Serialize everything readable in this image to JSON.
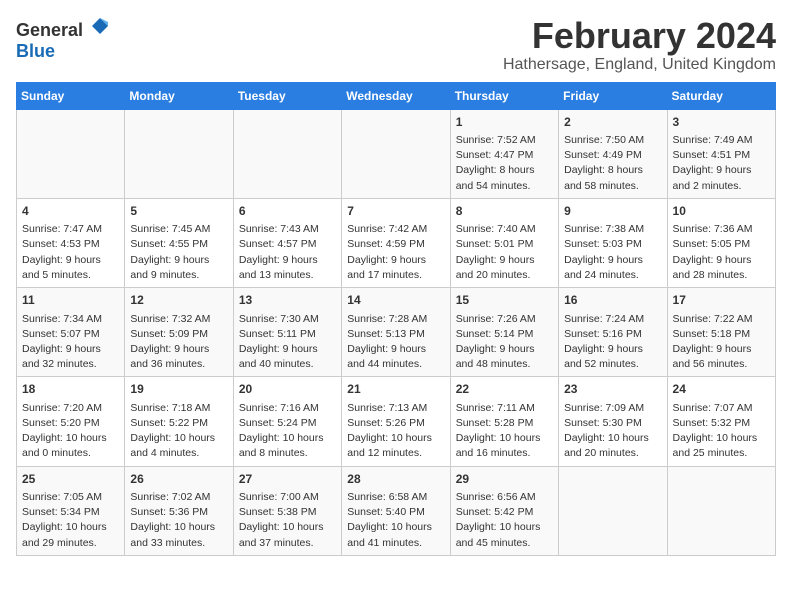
{
  "header": {
    "logo_general": "General",
    "logo_blue": "Blue",
    "month": "February 2024",
    "location": "Hathersage, England, United Kingdom"
  },
  "days_of_week": [
    "Sunday",
    "Monday",
    "Tuesday",
    "Wednesday",
    "Thursday",
    "Friday",
    "Saturday"
  ],
  "weeks": [
    [
      {
        "day": "",
        "info": ""
      },
      {
        "day": "",
        "info": ""
      },
      {
        "day": "",
        "info": ""
      },
      {
        "day": "",
        "info": ""
      },
      {
        "day": "1",
        "info": "Sunrise: 7:52 AM\nSunset: 4:47 PM\nDaylight: 8 hours\nand 54 minutes."
      },
      {
        "day": "2",
        "info": "Sunrise: 7:50 AM\nSunset: 4:49 PM\nDaylight: 8 hours\nand 58 minutes."
      },
      {
        "day": "3",
        "info": "Sunrise: 7:49 AM\nSunset: 4:51 PM\nDaylight: 9 hours\nand 2 minutes."
      }
    ],
    [
      {
        "day": "4",
        "info": "Sunrise: 7:47 AM\nSunset: 4:53 PM\nDaylight: 9 hours\nand 5 minutes."
      },
      {
        "day": "5",
        "info": "Sunrise: 7:45 AM\nSunset: 4:55 PM\nDaylight: 9 hours\nand 9 minutes."
      },
      {
        "day": "6",
        "info": "Sunrise: 7:43 AM\nSunset: 4:57 PM\nDaylight: 9 hours\nand 13 minutes."
      },
      {
        "day": "7",
        "info": "Sunrise: 7:42 AM\nSunset: 4:59 PM\nDaylight: 9 hours\nand 17 minutes."
      },
      {
        "day": "8",
        "info": "Sunrise: 7:40 AM\nSunset: 5:01 PM\nDaylight: 9 hours\nand 20 minutes."
      },
      {
        "day": "9",
        "info": "Sunrise: 7:38 AM\nSunset: 5:03 PM\nDaylight: 9 hours\nand 24 minutes."
      },
      {
        "day": "10",
        "info": "Sunrise: 7:36 AM\nSunset: 5:05 PM\nDaylight: 9 hours\nand 28 minutes."
      }
    ],
    [
      {
        "day": "11",
        "info": "Sunrise: 7:34 AM\nSunset: 5:07 PM\nDaylight: 9 hours\nand 32 minutes."
      },
      {
        "day": "12",
        "info": "Sunrise: 7:32 AM\nSunset: 5:09 PM\nDaylight: 9 hours\nand 36 minutes."
      },
      {
        "day": "13",
        "info": "Sunrise: 7:30 AM\nSunset: 5:11 PM\nDaylight: 9 hours\nand 40 minutes."
      },
      {
        "day": "14",
        "info": "Sunrise: 7:28 AM\nSunset: 5:13 PM\nDaylight: 9 hours\nand 44 minutes."
      },
      {
        "day": "15",
        "info": "Sunrise: 7:26 AM\nSunset: 5:14 PM\nDaylight: 9 hours\nand 48 minutes."
      },
      {
        "day": "16",
        "info": "Sunrise: 7:24 AM\nSunset: 5:16 PM\nDaylight: 9 hours\nand 52 minutes."
      },
      {
        "day": "17",
        "info": "Sunrise: 7:22 AM\nSunset: 5:18 PM\nDaylight: 9 hours\nand 56 minutes."
      }
    ],
    [
      {
        "day": "18",
        "info": "Sunrise: 7:20 AM\nSunset: 5:20 PM\nDaylight: 10 hours\nand 0 minutes."
      },
      {
        "day": "19",
        "info": "Sunrise: 7:18 AM\nSunset: 5:22 PM\nDaylight: 10 hours\nand 4 minutes."
      },
      {
        "day": "20",
        "info": "Sunrise: 7:16 AM\nSunset: 5:24 PM\nDaylight: 10 hours\nand 8 minutes."
      },
      {
        "day": "21",
        "info": "Sunrise: 7:13 AM\nSunset: 5:26 PM\nDaylight: 10 hours\nand 12 minutes."
      },
      {
        "day": "22",
        "info": "Sunrise: 7:11 AM\nSunset: 5:28 PM\nDaylight: 10 hours\nand 16 minutes."
      },
      {
        "day": "23",
        "info": "Sunrise: 7:09 AM\nSunset: 5:30 PM\nDaylight: 10 hours\nand 20 minutes."
      },
      {
        "day": "24",
        "info": "Sunrise: 7:07 AM\nSunset: 5:32 PM\nDaylight: 10 hours\nand 25 minutes."
      }
    ],
    [
      {
        "day": "25",
        "info": "Sunrise: 7:05 AM\nSunset: 5:34 PM\nDaylight: 10 hours\nand 29 minutes."
      },
      {
        "day": "26",
        "info": "Sunrise: 7:02 AM\nSunset: 5:36 PM\nDaylight: 10 hours\nand 33 minutes."
      },
      {
        "day": "27",
        "info": "Sunrise: 7:00 AM\nSunset: 5:38 PM\nDaylight: 10 hours\nand 37 minutes."
      },
      {
        "day": "28",
        "info": "Sunrise: 6:58 AM\nSunset: 5:40 PM\nDaylight: 10 hours\nand 41 minutes."
      },
      {
        "day": "29",
        "info": "Sunrise: 6:56 AM\nSunset: 5:42 PM\nDaylight: 10 hours\nand 45 minutes."
      },
      {
        "day": "",
        "info": ""
      },
      {
        "day": "",
        "info": ""
      }
    ]
  ]
}
